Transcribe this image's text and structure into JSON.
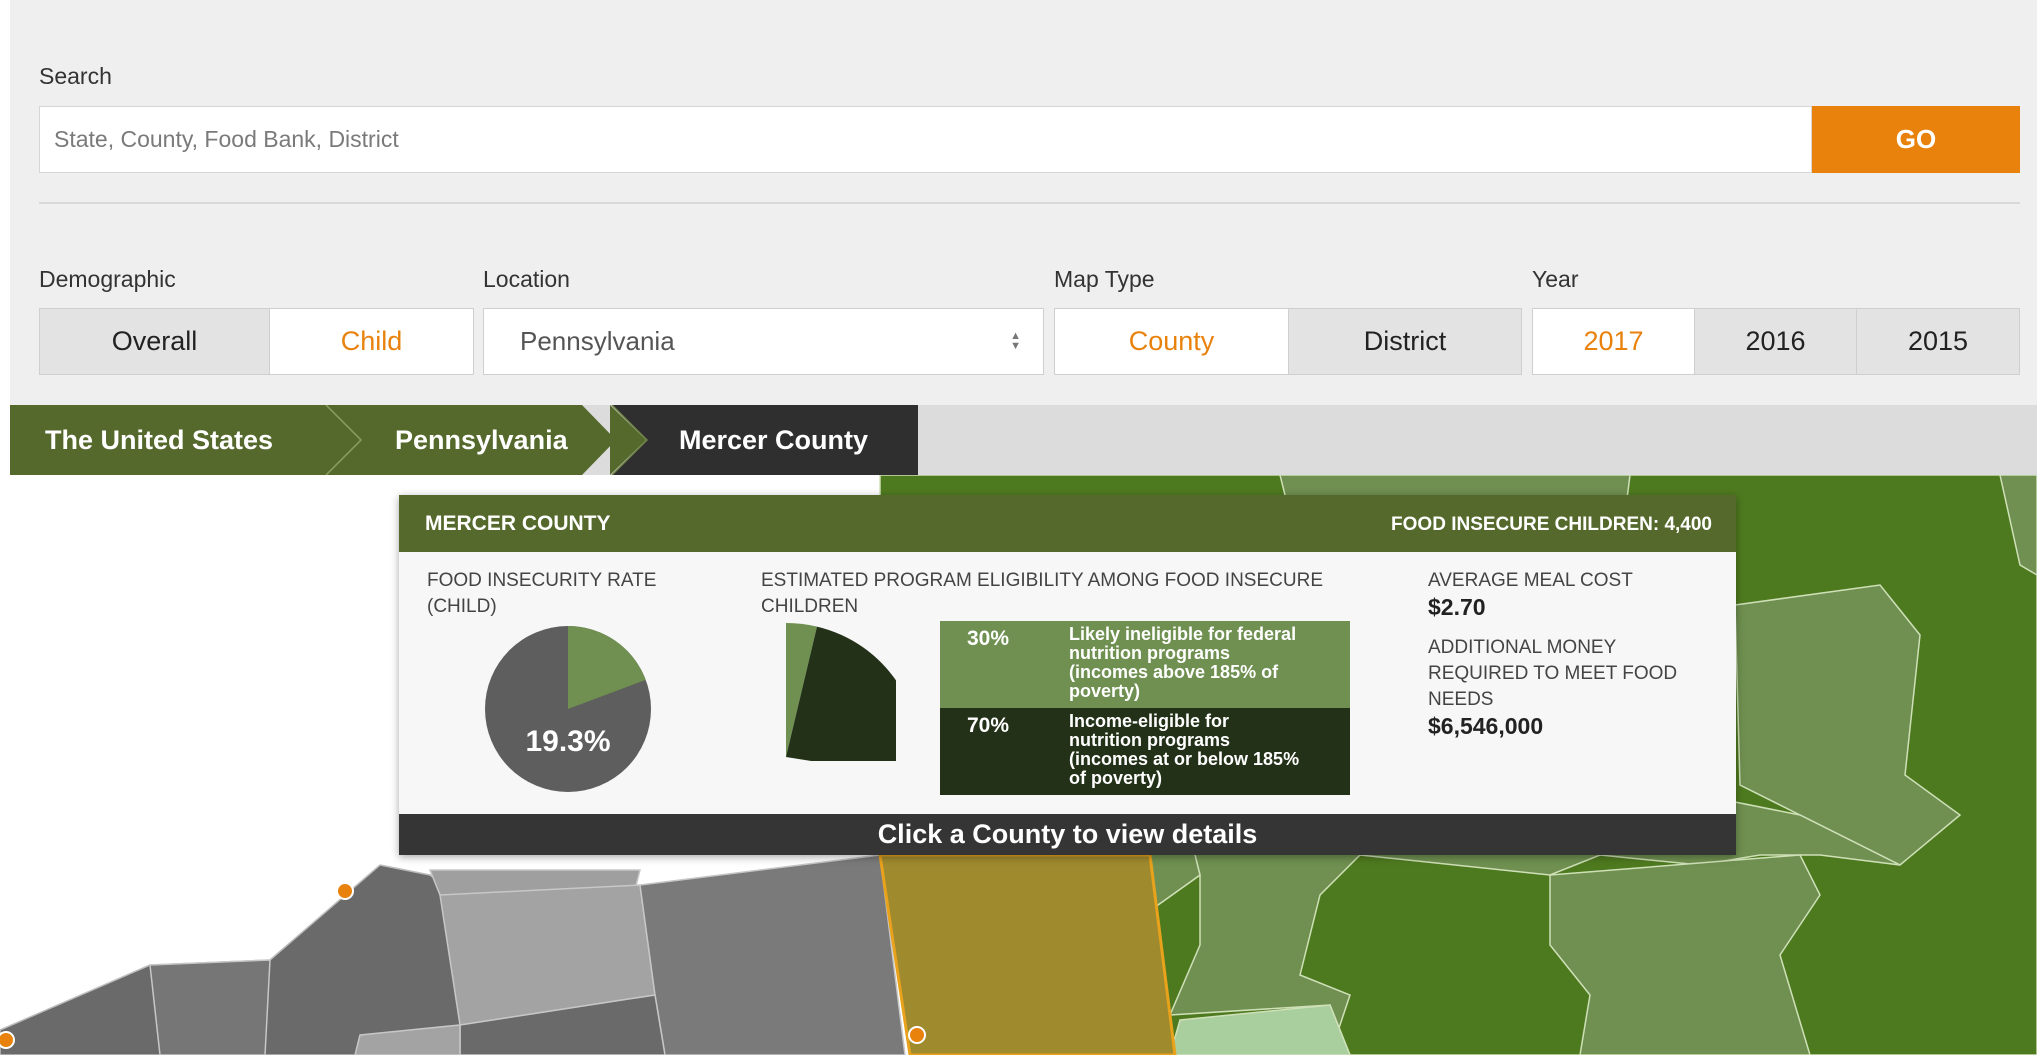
{
  "search": {
    "label": "Search",
    "placeholder": "State, County, Food Bank, District",
    "value": "",
    "go_label": "GO"
  },
  "filters": {
    "demographic": {
      "label": "Demographic",
      "options": [
        "Overall",
        "Child"
      ],
      "selected": "Child"
    },
    "location": {
      "label": "Location",
      "value": "Pennsylvania"
    },
    "map_type": {
      "label": "Map Type",
      "options": [
        "County",
        "District"
      ],
      "selected": "County"
    },
    "year": {
      "label": "Year",
      "options": [
        "2017",
        "2016",
        "2015"
      ],
      "selected": "2017"
    }
  },
  "breadcrumb": [
    "The United States",
    "Pennsylvania",
    "Mercer County"
  ],
  "popup": {
    "title": "MERCER COUNTY",
    "headline": "FOOD INSECURE CHILDREN: 4,400",
    "rate_label_1": "FOOD INSECURITY RATE",
    "rate_label_2": "(CHILD)",
    "rate_value": "19.3%",
    "rate_fraction": 0.193,
    "eligibility_label_1": "ESTIMATED PROGRAM ELIGIBILITY AMONG FOOD INSECURE",
    "eligibility_label_2": "CHILDREN",
    "eligibility": [
      {
        "pct": "30%",
        "lines": [
          "Likely ineligible for federal",
          "nutrition programs",
          "(incomes above 185% of",
          "poverty)"
        ]
      },
      {
        "pct": "70%",
        "lines": [
          "Income-eligible for",
          "nutrition programs",
          "(incomes at or below 185%",
          "of poverty)"
        ]
      }
    ],
    "meal_cost_label": "AVERAGE MEAL COST",
    "meal_cost_value": "$2.70",
    "additional_label_1": "ADDITIONAL MONEY",
    "additional_label_2": "REQUIRED TO MEET FOOD",
    "additional_label_3": "NEEDS",
    "additional_value": "$6,546,000",
    "footer": "Click a County to view details"
  },
  "colors": {
    "accent": "#e8820c",
    "header_green": "#54692b",
    "dark_green": "#233119",
    "mid_green": "#6f9050",
    "selected_county": "#a08a2e"
  }
}
